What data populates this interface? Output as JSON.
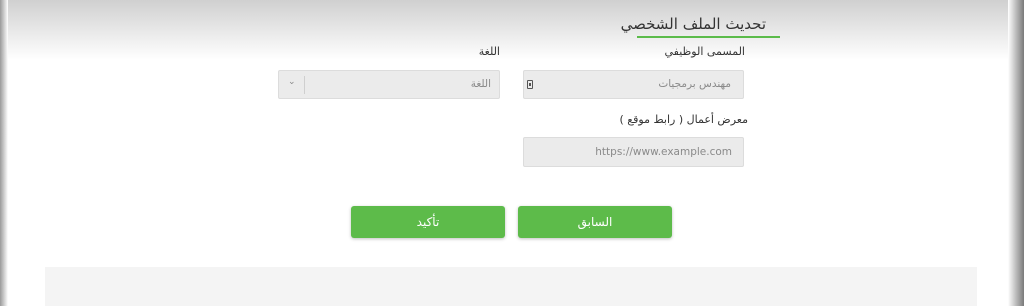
{
  "form": {
    "title": "تحديث الملف الشخصي",
    "job_title": {
      "label": "المسمى الوظيفي",
      "value": "مهندس برمجيات"
    },
    "language": {
      "label": "اللغة",
      "placeholder": "اللغة"
    },
    "portfolio": {
      "label": "معرض أعمال ( رابط موقع )",
      "placeholder": "https://www.example.com"
    }
  },
  "buttons": {
    "previous": "السابق",
    "confirm": "تأكيد"
  },
  "icons": {
    "job_field_icon": "id-card-icon",
    "language_dropdown_icon": "chevron-down-icon"
  },
  "colors": {
    "accent": "#5dbb4a"
  }
}
